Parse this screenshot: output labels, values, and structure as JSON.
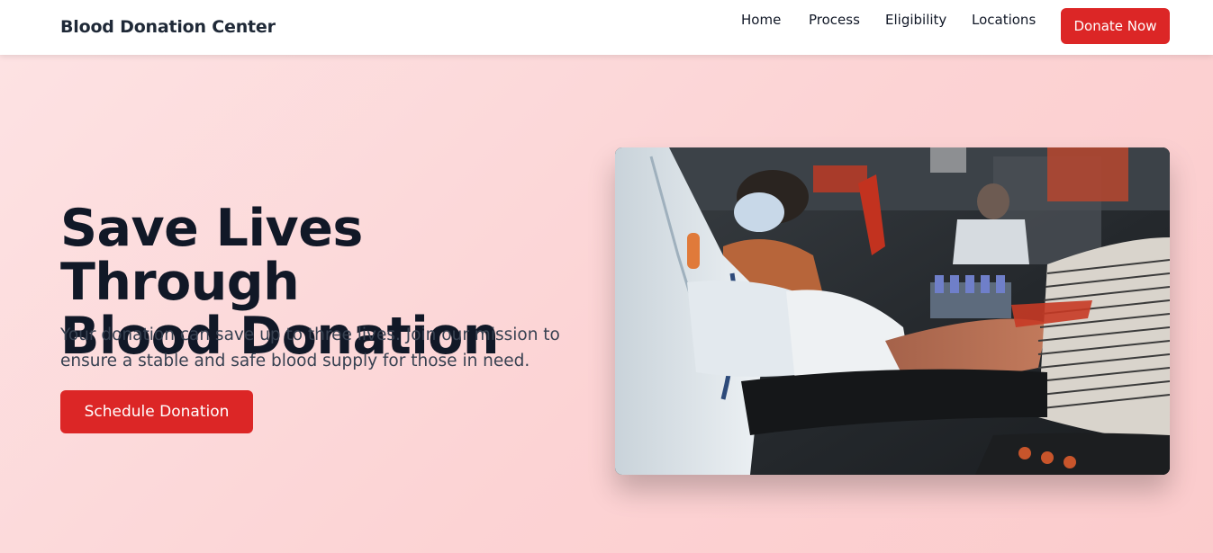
{
  "header": {
    "brand": "Blood Donation Center",
    "nav": [
      {
        "label": "Home"
      },
      {
        "label": "Process"
      },
      {
        "label": "Eligibility"
      },
      {
        "label": "Locations"
      }
    ],
    "cta_label": "Donate Now"
  },
  "hero": {
    "title_line1": "Save Lives Through",
    "title_line2": "Blood Donation",
    "description": "Your donation can save up to three lives. Join our mission to ensure a stable and safe blood supply for those in need.",
    "button_label": "Schedule Donation",
    "image_subject": "blood donation in progress"
  },
  "colors": {
    "accent": "#dc2626",
    "hero_background": "#fcd3d4",
    "heading": "#111827",
    "body_text": "#374151"
  }
}
